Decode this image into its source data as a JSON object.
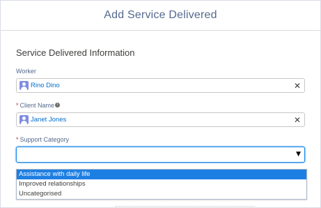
{
  "modal": {
    "title": "Add Service Delivered"
  },
  "section": {
    "title": "Service Delivered Information"
  },
  "fields": {
    "worker": {
      "label": "Worker",
      "value": "Rino Dino",
      "required": false,
      "icon": "user-avatar-icon"
    },
    "client_name": {
      "label": "Client Name",
      "value": "Janet Jones",
      "required": true,
      "required_marker": "*",
      "info_icon": "i",
      "icon": "user-avatar-icon"
    },
    "support_category": {
      "label": "Support Category",
      "value": "",
      "required": true,
      "required_marker": "*",
      "arrow": "▼",
      "options": [
        "Assistance with daily life",
        "Improved relationships",
        "Uncategorised"
      ],
      "highlighted_index": 0
    }
  },
  "icons": {
    "clear": "✕"
  },
  "colors": {
    "accent": "#1e7fe3",
    "link": "#006dcc",
    "required": "#c23934",
    "avatar": "#7f8de1"
  }
}
